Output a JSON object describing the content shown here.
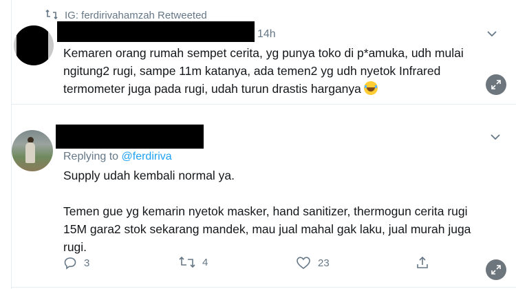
{
  "retweet_header": {
    "text": "IG: ferdirivahamzah Retweeted"
  },
  "tweet1": {
    "time": "14h",
    "text": "Kemaren orang rumah sempet cerita, yg punya toko di p*amuka, udh mulai ngitung2 rugi, sampe 11m katanya, ada temen2 yg udh nyetok Infrared termometer juga pada rugi, udah turun drastis harganya"
  },
  "tweet2": {
    "replying_prefix": "Replying to",
    "replying_handle": "@ferdiriva",
    "para1": "Supply udah kembali normal ya.",
    "para2": "Temen gue yg kemarin nyetok masker, hand sanitizer, thermogun cerita rugi 15M gara2 stok sekarang mandek, mau jual mahal gak laku, jual murah juga rugi.",
    "actions": {
      "reply_count": "3",
      "retweet_count": "4",
      "like_count": "23"
    }
  },
  "colors": {
    "secondary_text": "#657786",
    "link": "#1da1f2",
    "divider": "#e6ecf0",
    "expand_button": "#6e767d"
  },
  "icons": {
    "retweet": "retweet-icon",
    "chevron": "chevron-down-icon",
    "expand": "expand-icon",
    "reply": "reply-icon",
    "like": "heart-icon",
    "share": "share-icon",
    "emoji": "tears-of-joy-emoji"
  }
}
